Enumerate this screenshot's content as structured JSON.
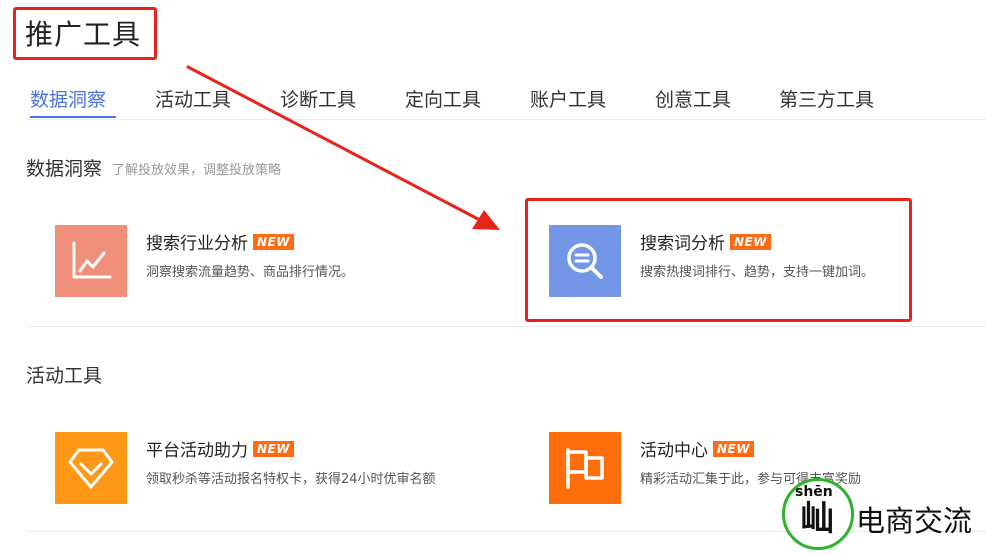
{
  "page": {
    "title": "推广工具"
  },
  "tabs": [
    {
      "label": "数据洞察",
      "active": true
    },
    {
      "label": "活动工具",
      "active": false
    },
    {
      "label": "诊断工具",
      "active": false
    },
    {
      "label": "定向工具",
      "active": false
    },
    {
      "label": "账户工具",
      "active": false
    },
    {
      "label": "创意工具",
      "active": false
    },
    {
      "label": "第三方工具",
      "active": false
    }
  ],
  "sections": [
    {
      "title": "数据洞察",
      "desc": "了解投放效果，调整投放策略",
      "cards": [
        {
          "title": "搜索行业分析",
          "badge": "NEW",
          "desc": "洞察搜索流量趋势、商品排行情况。",
          "icon": "line-chart-icon",
          "color": "#f0907a"
        },
        {
          "title": "搜索词分析",
          "badge": "NEW",
          "desc": "搜索热搜词排行、趋势，支持一键加词。",
          "icon": "search-keyword-icon",
          "color": "#7496e6"
        }
      ]
    },
    {
      "title": "活动工具",
      "desc": "",
      "cards": [
        {
          "title": "平台活动助力",
          "badge": "NEW",
          "desc": "领取秒杀等活动报名特权卡，获得24小时优审名额",
          "icon": "diamond-icon",
          "color": "#ff9717"
        },
        {
          "title": "活动中心",
          "badge": "NEW",
          "desc": "精彩活动汇集于此，参与可得丰富奖励",
          "icon": "flag-icon",
          "color": "#ff6c0a"
        }
      ]
    }
  ],
  "colors": {
    "accent": "#4e73df",
    "annotation_red": "#e8231a",
    "badge": "#ff6a13"
  },
  "watermark": {
    "pinyin": "shēn",
    "glyph": "屾",
    "text": "电商交流"
  }
}
